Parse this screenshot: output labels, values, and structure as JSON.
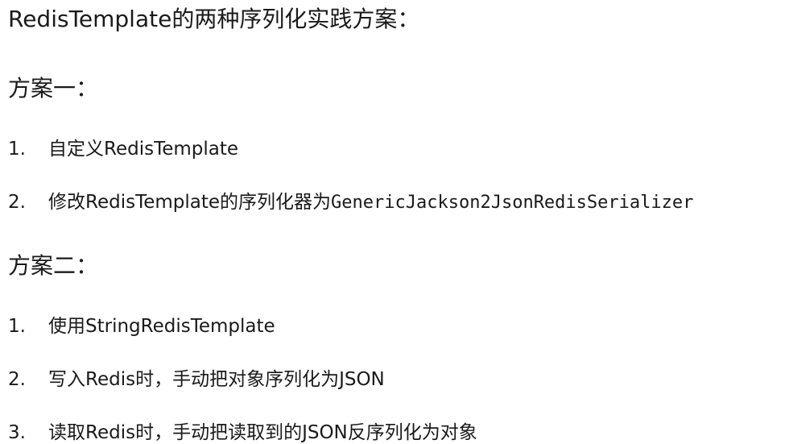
{
  "title": "RedisTemplate的两种序列化实践方案：",
  "plan1": {
    "heading": "方案一：",
    "items": [
      {
        "num": "1.",
        "text": "自定义RedisTemplate"
      },
      {
        "num": "2.",
        "text": "修改RedisTemplate的序列化器为",
        "code": "GenericJackson2JsonRedisSerializer"
      }
    ]
  },
  "plan2": {
    "heading": "方案二：",
    "items": [
      {
        "num": "1.",
        "text": "使用StringRedisTemplate"
      },
      {
        "num": "2.",
        "text": "写入Redis时，手动把对象序列化为JSON"
      },
      {
        "num": "3.",
        "text": "读取Redis时，手动把读取到的JSON反序列化为对象"
      }
    ]
  }
}
